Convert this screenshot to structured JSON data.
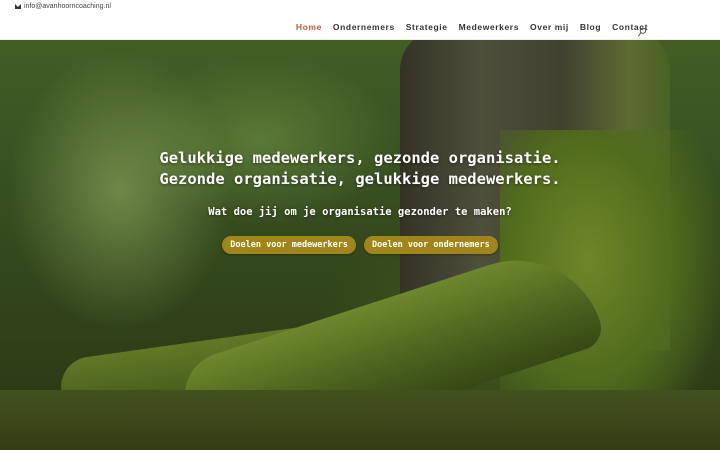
{
  "topbar": {
    "email": "info@avanhoorncoaching.nl",
    "mail_icon": "mail-icon"
  },
  "nav": {
    "items": [
      {
        "label": "Home",
        "active": true
      },
      {
        "label": "Ondernemers"
      },
      {
        "label": "Strategie"
      },
      {
        "label": "Medewerkers"
      },
      {
        "label": "Over mij"
      },
      {
        "label": "Blog"
      },
      {
        "label": "Contact"
      }
    ],
    "search_icon": "search-icon",
    "active_color": "#c05a38"
  },
  "hero": {
    "title_line1": "Gelukkige medewerkers, gezonde organisatie.",
    "title_line2": "Gezonde organisatie, gelukkige medewerkers.",
    "subtitle": "Wat doe jij om je organisatie gezonder te maken?",
    "buttons": [
      {
        "label": "Doelen voor medewerkers"
      },
      {
        "label": "Doelen voor ondernemers"
      }
    ],
    "button_color": "#a0861a"
  }
}
